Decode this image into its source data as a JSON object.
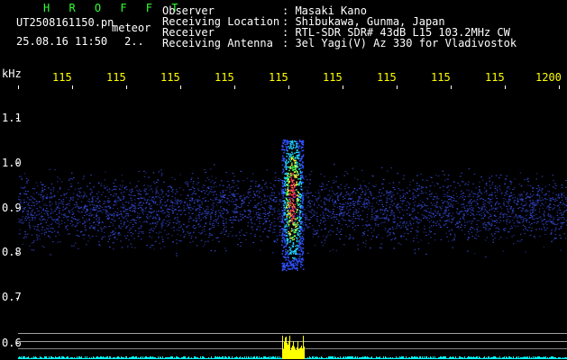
{
  "header": {
    "app_name": "H R O F F T",
    "filename": "UT2508161150.pn",
    "event_type": "meteor",
    "timestamp": "25.08.16 11:50",
    "page_indicator": "2..",
    "info_labels": [
      "Observer",
      "Receiving Location",
      "Receiver",
      "Receiving Antenna"
    ],
    "info_values": [
      ": Masaki Kano",
      ": Shibukawa, Gunma, Japan",
      ": RTL-SDR SDR# 43dB L15 103.2MHz CW",
      ": 3el Yagi(V) Az 330 for Vladivostok"
    ]
  },
  "axis": {
    "y_unit": "kHz",
    "y_ticks": [
      "1.1",
      "1.0",
      "0.9",
      "0.8",
      "0.7",
      "0.6"
    ],
    "x_ticks": [
      "115",
      "115",
      "115",
      "115",
      "115",
      "115",
      "115",
      "115",
      "115",
      "1200"
    ]
  },
  "colors": {
    "background": "#000000",
    "label_text": "#ffffff",
    "tick_text": "#ffff00",
    "title_text": "#33ff33",
    "noise": "#1a2fa0",
    "signal_peak": "#ff2060",
    "baseline": "#00ffff",
    "level_bar": "#ffff00"
  }
}
